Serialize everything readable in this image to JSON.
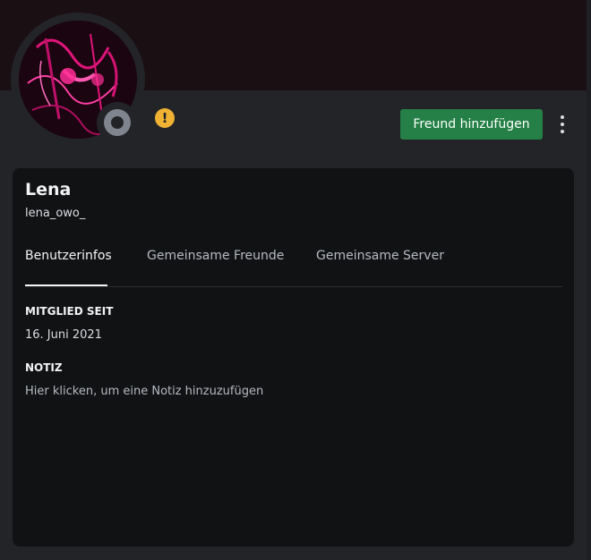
{
  "profile": {
    "display_name": "Lena",
    "username": "lena_owo_",
    "status": "offline"
  },
  "icons": {
    "warning": "!",
    "warning_color": "#f0b232"
  },
  "actions": {
    "add_friend_label": "Freund hinzufügen",
    "add_friend_color": "#248046"
  },
  "tabs": [
    {
      "label": "Benutzerinfos",
      "active": true
    },
    {
      "label": "Gemeinsame Freunde",
      "active": false
    },
    {
      "label": "Gemeinsame Server",
      "active": false
    }
  ],
  "sections": {
    "member_since": {
      "title": "MITGLIED SEIT",
      "value": "16. Juni 2021"
    },
    "note": {
      "title": "NOTIZ",
      "placeholder": "Hier klicken, um eine Notiz hinzuzufügen"
    }
  }
}
